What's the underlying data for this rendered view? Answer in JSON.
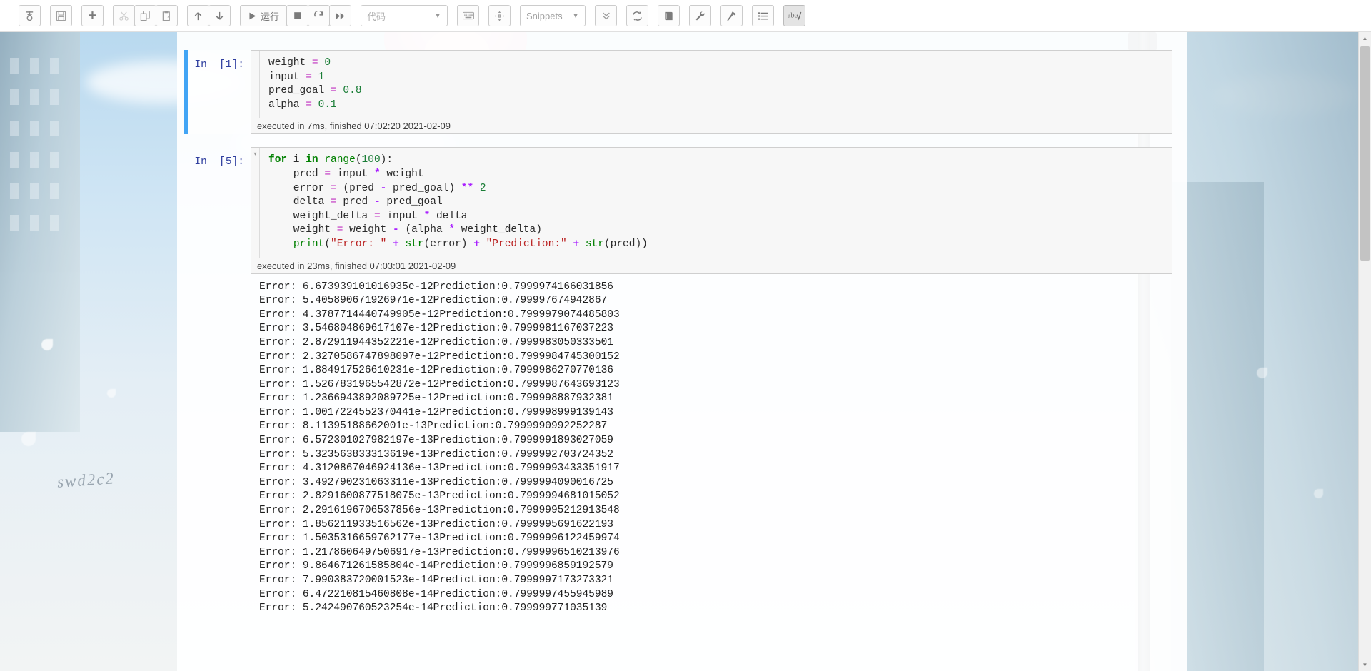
{
  "toolbar": {
    "groups": [
      {
        "buttons": [
          {
            "name": "save-checkpoint-button",
            "icon": "floppy-icon",
            "label": "",
            "state": "normal"
          }
        ]
      },
      {
        "buttons": [
          {
            "name": "save-button",
            "icon": "save-disk-icon",
            "label": "",
            "state": "normal"
          }
        ]
      },
      {
        "buttons": [
          {
            "name": "insert-cell-below-button",
            "icon": "plus-icon",
            "label": "+",
            "state": "normal"
          }
        ]
      },
      {
        "buttons": [
          {
            "name": "cut-cell-button",
            "icon": "scissors-icon",
            "label": "",
            "state": "disabled"
          },
          {
            "name": "copy-cell-button",
            "icon": "copy-icon",
            "label": "",
            "state": "normal"
          },
          {
            "name": "paste-cell-button",
            "icon": "paste-icon",
            "label": "",
            "state": "normal"
          }
        ]
      },
      {
        "buttons": [
          {
            "name": "move-cell-up-button",
            "icon": "arrow-up-icon",
            "label": "",
            "state": "normal"
          },
          {
            "name": "move-cell-down-button",
            "icon": "arrow-down-icon",
            "label": "",
            "state": "normal"
          }
        ]
      },
      {
        "buttons": [
          {
            "name": "run-cell-button",
            "icon": "play-icon",
            "label": "运行",
            "state": "normal"
          },
          {
            "name": "interrupt-kernel-button",
            "icon": "stop-square-icon",
            "label": "",
            "state": "normal"
          },
          {
            "name": "restart-kernel-button",
            "icon": "restart-circle-icon",
            "label": "",
            "state": "normal"
          },
          {
            "name": "restart-and-run-all-button",
            "icon": "fast-forward-icon",
            "label": "",
            "state": "normal"
          }
        ]
      }
    ],
    "cell_type_select": {
      "name": "cell-type-select",
      "value": "代码",
      "caret": "chevron-down-icon"
    },
    "right_buttons_a": [
      {
        "name": "keyboard-shortcuts-button",
        "icon": "keyboard-icon"
      },
      {
        "name": "command-palette-button",
        "icon": "crosshair-icon"
      }
    ],
    "snippets_select": {
      "name": "snippets-menu",
      "value": "Snippets",
      "caret": "chevron-down-icon"
    },
    "right_buttons_b": [
      {
        "name": "collapse-all-button",
        "icon": "double-chevron-down-icon"
      },
      {
        "name": "reload-extensions-button",
        "icon": "refresh-cycle-icon"
      },
      {
        "name": "table-of-contents-button",
        "icon": "book-icon"
      },
      {
        "name": "variable-inspector-button",
        "icon": "wrench-icon"
      },
      {
        "name": "nbextensions-config-button",
        "icon": "hammer-icon"
      },
      {
        "name": "toc-sidebar-button",
        "icon": "list-icon"
      },
      {
        "name": "spellcheck-button",
        "icon": "abc-spellcheck-icon",
        "state": "active"
      }
    ]
  },
  "notebook": {
    "cells": [
      {
        "prompt": "In  [1]:",
        "selected": true,
        "collapser": "",
        "code_lines": [
          [
            {
              "t": "weight ",
              "c": "plain"
            },
            {
              "t": "=",
              "c": "eq"
            },
            {
              "t": " ",
              "c": "plain"
            },
            {
              "t": "0",
              "c": "num"
            }
          ],
          [
            {
              "t": "input ",
              "c": "plain"
            },
            {
              "t": "=",
              "c": "eq"
            },
            {
              "t": " ",
              "c": "plain"
            },
            {
              "t": "1",
              "c": "num"
            }
          ],
          [
            {
              "t": "pred_goal ",
              "c": "plain"
            },
            {
              "t": "=",
              "c": "eq"
            },
            {
              "t": " ",
              "c": "plain"
            },
            {
              "t": "0.8",
              "c": "num"
            }
          ],
          [
            {
              "t": "alpha ",
              "c": "plain"
            },
            {
              "t": "=",
              "c": "eq"
            },
            {
              "t": " ",
              "c": "plain"
            },
            {
              "t": "0.1",
              "c": "num"
            }
          ]
        ],
        "exec_status": "executed in 7ms, finished 07:02:20 2021-02-09",
        "output_lines": []
      },
      {
        "prompt": "In  [5]:",
        "selected": false,
        "collapser": "▾",
        "code_lines": [
          [
            {
              "t": "for",
              "c": "kw"
            },
            {
              "t": " i ",
              "c": "plain"
            },
            {
              "t": "in",
              "c": "kw"
            },
            {
              "t": " ",
              "c": "plain"
            },
            {
              "t": "range",
              "c": "bi"
            },
            {
              "t": "(",
              "c": "plain"
            },
            {
              "t": "100",
              "c": "num"
            },
            {
              "t": "):",
              "c": "plain"
            }
          ],
          [
            {
              "t": "    pred ",
              "c": "plain"
            },
            {
              "t": "=",
              "c": "eq"
            },
            {
              "t": " input ",
              "c": "plain"
            },
            {
              "t": "*",
              "c": "op"
            },
            {
              "t": " weight",
              "c": "plain"
            }
          ],
          [
            {
              "t": "    error ",
              "c": "plain"
            },
            {
              "t": "=",
              "c": "eq"
            },
            {
              "t": " (pred ",
              "c": "plain"
            },
            {
              "t": "-",
              "c": "op"
            },
            {
              "t": " pred_goal) ",
              "c": "plain"
            },
            {
              "t": "**",
              "c": "op"
            },
            {
              "t": " ",
              "c": "plain"
            },
            {
              "t": "2",
              "c": "num"
            }
          ],
          [
            {
              "t": "    delta ",
              "c": "plain"
            },
            {
              "t": "=",
              "c": "eq"
            },
            {
              "t": " pred ",
              "c": "plain"
            },
            {
              "t": "-",
              "c": "op"
            },
            {
              "t": " pred_goal",
              "c": "plain"
            }
          ],
          [
            {
              "t": "    weight_delta ",
              "c": "plain"
            },
            {
              "t": "=",
              "c": "eq"
            },
            {
              "t": " input ",
              "c": "plain"
            },
            {
              "t": "*",
              "c": "op"
            },
            {
              "t": " delta",
              "c": "plain"
            }
          ],
          [
            {
              "t": "    weight ",
              "c": "plain"
            },
            {
              "t": "=",
              "c": "eq"
            },
            {
              "t": " weight ",
              "c": "plain"
            },
            {
              "t": "-",
              "c": "op"
            },
            {
              "t": " (alpha ",
              "c": "plain"
            },
            {
              "t": "*",
              "c": "op"
            },
            {
              "t": " weight_delta)",
              "c": "plain"
            }
          ],
          [
            {
              "t": "    ",
              "c": "plain"
            },
            {
              "t": "print",
              "c": "bi"
            },
            {
              "t": "(",
              "c": "plain"
            },
            {
              "t": "\"Error: \"",
              "c": "str"
            },
            {
              "t": " ",
              "c": "plain"
            },
            {
              "t": "+",
              "c": "op"
            },
            {
              "t": " ",
              "c": "plain"
            },
            {
              "t": "str",
              "c": "bi"
            },
            {
              "t": "(error) ",
              "c": "plain"
            },
            {
              "t": "+",
              "c": "op"
            },
            {
              "t": " ",
              "c": "plain"
            },
            {
              "t": "\"Prediction:\"",
              "c": "str"
            },
            {
              "t": " ",
              "c": "plain"
            },
            {
              "t": "+",
              "c": "op"
            },
            {
              "t": " ",
              "c": "plain"
            },
            {
              "t": "str",
              "c": "bi"
            },
            {
              "t": "(pred))",
              "c": "plain"
            }
          ]
        ],
        "exec_status": "executed in 23ms, finished 07:03:01 2021-02-09",
        "output_lines": [
          "Error: 6.673939101016935e-12Prediction:0.7999974166031856",
          "Error: 5.405890671926971e-12Prediction:0.799997674942867",
          "Error: 4.3787714440749905e-12Prediction:0.7999979074485803",
          "Error: 3.546804869617107e-12Prediction:0.7999981167037223",
          "Error: 2.872911944352221e-12Prediction:0.7999983050333501",
          "Error: 2.3270586747898097e-12Prediction:0.7999984745300152",
          "Error: 1.884917526610231e-12Prediction:0.7999986270770136",
          "Error: 1.5267831965542872e-12Prediction:0.7999987643693123",
          "Error: 1.2366943892089725e-12Prediction:0.799998887932381",
          "Error: 1.0017224552370441e-12Prediction:0.799998999139143",
          "Error: 8.11395188662001e-13Prediction:0.7999990992252287",
          "Error: 6.572301027982197e-13Prediction:0.7999991893027059",
          "Error: 5.323563833313619e-13Prediction:0.7999992703724352",
          "Error: 4.3120867046924136e-13Prediction:0.7999993433351917",
          "Error: 3.492790231063311e-13Prediction:0.7999994090016725",
          "Error: 2.8291600877518075e-13Prediction:0.7999994681015052",
          "Error: 2.2916196706537856e-13Prediction:0.7999995212913548",
          "Error: 1.856211933516562e-13Prediction:0.7999995691622193",
          "Error: 1.5035316659762177e-13Prediction:0.7999996122459974",
          "Error: 1.2178606497506917e-13Prediction:0.7999996510213976",
          "Error: 9.864671261585804e-14Prediction:0.7999996859192579",
          "Error: 7.990383720001523e-14Prediction:0.7999997173273321",
          "Error: 6.472210815460808e-14Prediction:0.7999997455945989",
          "Error: 5.242490760523254e-14Prediction:0.799999771035139"
        ]
      }
    ]
  },
  "wallpaper": {
    "watermark": "swd2c2"
  },
  "scrollbar": {
    "up_arrow": "▲",
    "down_arrow": "▼"
  }
}
